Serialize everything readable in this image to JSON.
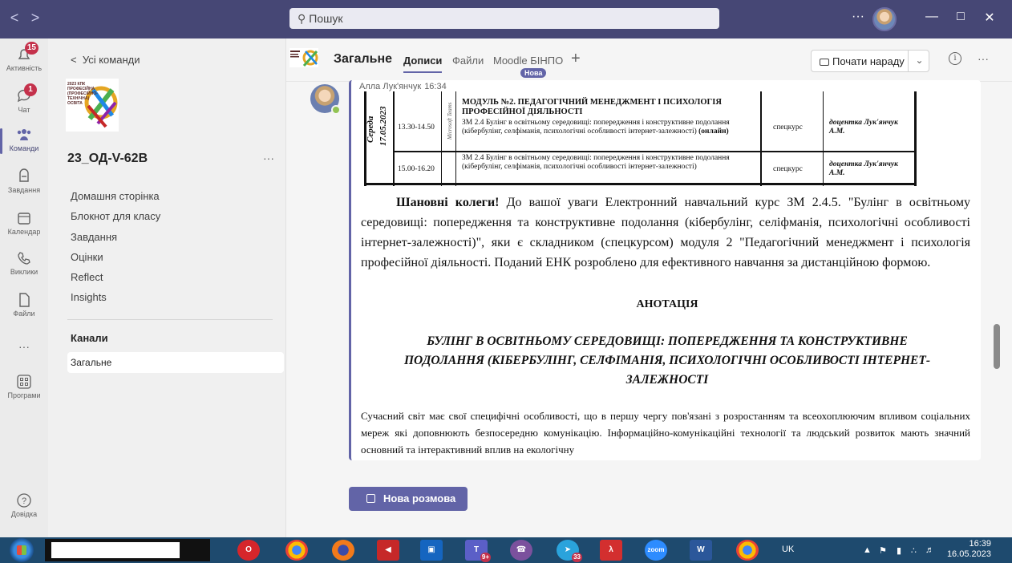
{
  "titlebar": {
    "search_placeholder": "Пошук",
    "more": "···"
  },
  "rail": [
    {
      "id": "activity",
      "label": "Активність",
      "badge": "15"
    },
    {
      "id": "chat",
      "label": "Чат",
      "badge": "1"
    },
    {
      "id": "teams",
      "label": "Команди",
      "active": true
    },
    {
      "id": "assignments",
      "label": "Завдання"
    },
    {
      "id": "calendar",
      "label": "Календар"
    },
    {
      "id": "calls",
      "label": "Виклики"
    },
    {
      "id": "files",
      "label": "Файли"
    },
    {
      "id": "more",
      "label": "···"
    },
    {
      "id": "apps",
      "label": "Програми"
    },
    {
      "id": "help",
      "label": "Довідка"
    }
  ],
  "teampanel": {
    "back_label": "Усі команди",
    "team_name": "23_ОД-V-62В",
    "team_more": "···",
    "logo_text": "2023 КПК ПРОФЕСІЙНА (ПРОФЕСІЙНО-ТЕХНІЧНА) ОСВІТА",
    "nav": [
      "Домашня сторінка",
      "Блокнот для класу",
      "Завдання",
      "Оцінки",
      "Reflect",
      "Insights"
    ],
    "channels_header": "Канали",
    "channels": [
      "Загальне"
    ]
  },
  "channel": {
    "title": "Загальне",
    "tabs": [
      "Дописи",
      "Файли",
      "Moodle БІНПО"
    ],
    "new_badge": "Нова",
    "add_tab": "+",
    "meet_label": "Почати нараду",
    "more": "···"
  },
  "post": {
    "author": "Алла Лук'янчук",
    "time": "16:34",
    "schedule": {
      "day": "Середа",
      "date": "17.05.2023",
      "platform": "Microsoft Teams",
      "module_title": "МОДУЛЬ №2. ПЕДАГОГІЧНИЙ МЕНЕДЖМЕНТ І ПСИХОЛОГІЯ ПРОФЕСІЙНОЇ ДІЯЛЬНОСТІ",
      "rows": [
        {
          "time": "13.30-14.50",
          "topic": "ЗМ 2.4 Булінг в освітньому середовищі: попередження і конструктивне подолання (кібербулінг, селфіманія, психологічні особливості інтернет-залежності)",
          "topic_suffix": "(онлайн)",
          "type": "спецкурс",
          "lecturer": "доцентка Лук'янчук А.М."
        },
        {
          "time": "15.00-16.20",
          "topic": "ЗМ 2.4 Булінг в освітньому середовищі: попередження і конструктивне подолання (кібербулінг, селфіманія, психологічні особливості інтернет-залежності)",
          "type": "спецкурс",
          "lecturer": "доцентка Лук'янчук А.М."
        }
      ]
    },
    "greeting_bold": "Шановні колеги!",
    "body": "До вашої уваги Електронний навчальний курс ЗМ 2.4.5. \"Булінг в освітньому середовищі: попередження та конструктивне подолання (кібербулінг, селіфманія, психологічні особливості інтернет-залежності)\", яки є складником (спецкурсом) модуля 2 \"Педагогічний менеджмент і психологія професійної діяльності. Поданий ЕНК розроблено для ефективного навчання за дистанційною формою.",
    "annotation_title": "АНОТАЦІЯ",
    "annotation_heading": "БУЛІНГ В ОСВІТНЬОМУ СЕРЕДОВИЩІ: ПОПЕРЕДЖЕННЯ ТА КОНСТРУКТИВНЕ ПОДОЛАННЯ (КІБЕРБУЛІНГ, СЕЛФІМАНІЯ, ПСИХОЛОГІЧНІ ОСОБЛИВОСТІ ІНТЕРНЕТ-ЗАЛЕЖНОСТІ",
    "annotation_para": "Сучасний світ має свої специфічні особливості, що в першу чергу пов'язані з розростанням та всеохоплюючим впливом соціальних мереж які доповнюють безпосередню комунікацію. Інформаційно-комунікаційні технології та людський розвиток мають значний основний та інтерактивний вплив на екологічну"
  },
  "new_conversation": "Нова розмова",
  "taskbar": {
    "apps": [
      "Opera",
      "Chrome",
      "Firefox",
      "Remote",
      "Save",
      "Teams",
      "Viber",
      "Telegram",
      "Acrobat",
      "Zoom",
      "Word",
      "Chrome"
    ],
    "teams_badge": "9+",
    "telegram_badge": "33",
    "lang": "UK",
    "time": "16:39",
    "date": "16.05.2023"
  },
  "colors": {
    "titlebar": "#464775",
    "accent": "#6264a7",
    "badge": "#c4314b",
    "presence": "#92c353",
    "taskbar": "#1e4a6e"
  }
}
